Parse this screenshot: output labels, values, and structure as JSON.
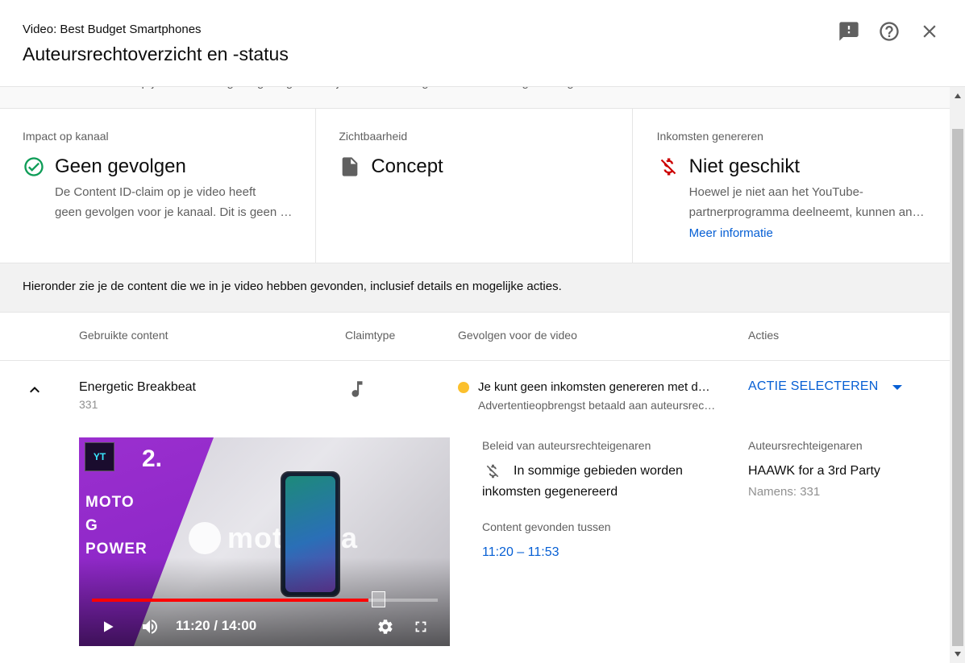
{
  "header": {
    "subtitle": "Video: Best Budget Smartphones",
    "title": "Auteursrechtoverzicht en -status",
    "icons": [
      "feedback-icon",
      "help-icon",
      "close-icon"
    ]
  },
  "cut_text": "De Content ID-claim op je video heeft geen gevolgen voor je kanaal. Dit is geen waarschuwing vanwege een auteursrechtinbreuk.",
  "cards": [
    {
      "heading": "Impact op kanaal",
      "icon": "check-circle-icon",
      "value": "Geen gevolgen",
      "desc_line1": "De Content ID-claim op je video heeft",
      "desc_line2": "geen gevolgen voor je kanaal. Dit is geen waarschuwing"
    },
    {
      "heading": "Zichtbaarheid",
      "icon": "document-icon",
      "value": "Concept"
    },
    {
      "heading": "Inkomsten genereren",
      "icon": "no-money-icon",
      "value": "Niet geschikt",
      "desc_line1": "Hoewel je niet aan het YouTube-",
      "desc_line2": "partnerprogramma deelneemt, kunnen anderen",
      "link": "Meer informatie"
    }
  ],
  "info_text": "Hieronder zie je de content die we in je video hebben gevonden, inclusief details en mogelijke acties.",
  "table": {
    "columns": [
      "Gebruikte content",
      "Claimtype",
      "Gevolgen voor de video",
      "Acties"
    ],
    "row": {
      "title": "Energetic Breakbeat",
      "sub": "331",
      "claim_icon": "music-note-icon",
      "effect_line1": "Je kunt geen inkomsten genereren met deze video",
      "effect_line2": "Advertentieopbrengst betaald aan auteursrechteigenaar",
      "status_color": "#fbc02d",
      "action": "ACTIE SELECTEREN"
    }
  },
  "player": {
    "logo_text": "YT",
    "overlay_number": "2.",
    "overlay_line1": "MOTO",
    "overlay_line2": "G",
    "overlay_line3": "POWER",
    "brand_word": "motorola",
    "time": "11:20 / 14:00",
    "progress": 0.8
  },
  "details": {
    "policy_label": "Beleid van auteursrechteigenaren",
    "policy_line1": "In sommige gebieden worden",
    "policy_line2": "inkomsten gegenereerd",
    "found_label": "Content gevonden tussen",
    "found_value": "11:20 – 11:53",
    "owners_label": "Auteursrechteigenaren",
    "owner_name": "HAAWK for a 3rd Party",
    "owner_sub": "Namens: 331"
  },
  "colors": {
    "accent": "#065fd4",
    "success": "#0f9d58",
    "danger": "#cc0000",
    "status_yellow": "#fbc02d",
    "progress_red": "#ff0000"
  }
}
